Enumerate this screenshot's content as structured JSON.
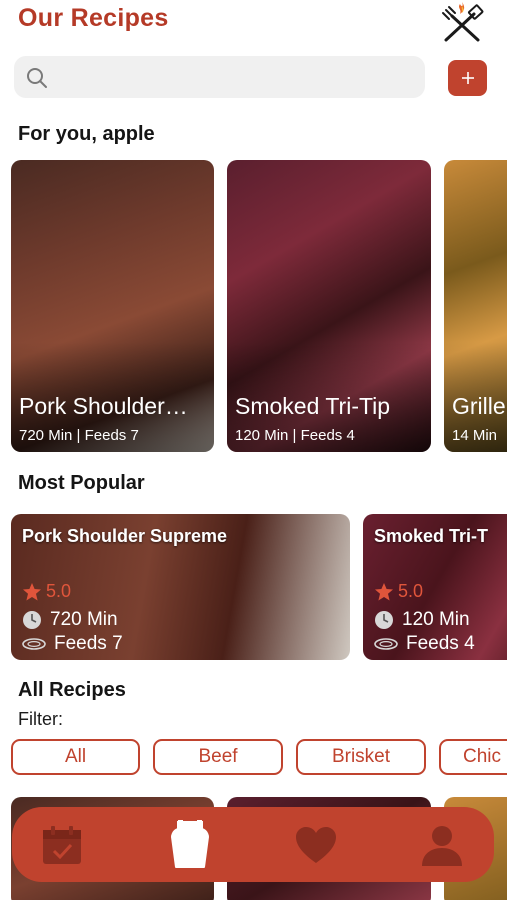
{
  "header": {
    "title": "Our Recipes",
    "logo_icon": "grill-tools-icon"
  },
  "search": {
    "placeholder": "",
    "value": ""
  },
  "add_button_icon": "plus-icon",
  "for_you": {
    "title": "For you, apple",
    "cards": [
      {
        "title": "Pork Shoulder…",
        "meta": "720 Min | Feeds 7"
      },
      {
        "title": "Smoked Tri-Tip",
        "meta": "120 Min | Feeds 4"
      },
      {
        "title": "Grille",
        "meta": "14 Min"
      }
    ]
  },
  "most_popular": {
    "title": "Most Popular",
    "cards": [
      {
        "title": "Pork Shoulder Supreme",
        "rating": "5.0",
        "time": "720 Min",
        "feeds": "Feeds 7"
      },
      {
        "title": "Smoked Tri-T",
        "rating": "5.0",
        "time": "120 Min",
        "feeds": "Feeds 4"
      }
    ]
  },
  "all_recipes": {
    "title": "All Recipes",
    "filter_label": "Filter:",
    "filters": [
      "All",
      "Beef",
      "Brisket",
      "Chic"
    ]
  },
  "nav": {
    "items": [
      {
        "icon": "calendar-check-icon"
      },
      {
        "icon": "apron-icon",
        "active": true
      },
      {
        "icon": "heart-icon"
      },
      {
        "icon": "profile-icon"
      }
    ]
  },
  "colors": {
    "brand": "#c0432e",
    "title": "#b53a27",
    "search_bg": "#f0f0f0",
    "star": "#e0553b"
  }
}
